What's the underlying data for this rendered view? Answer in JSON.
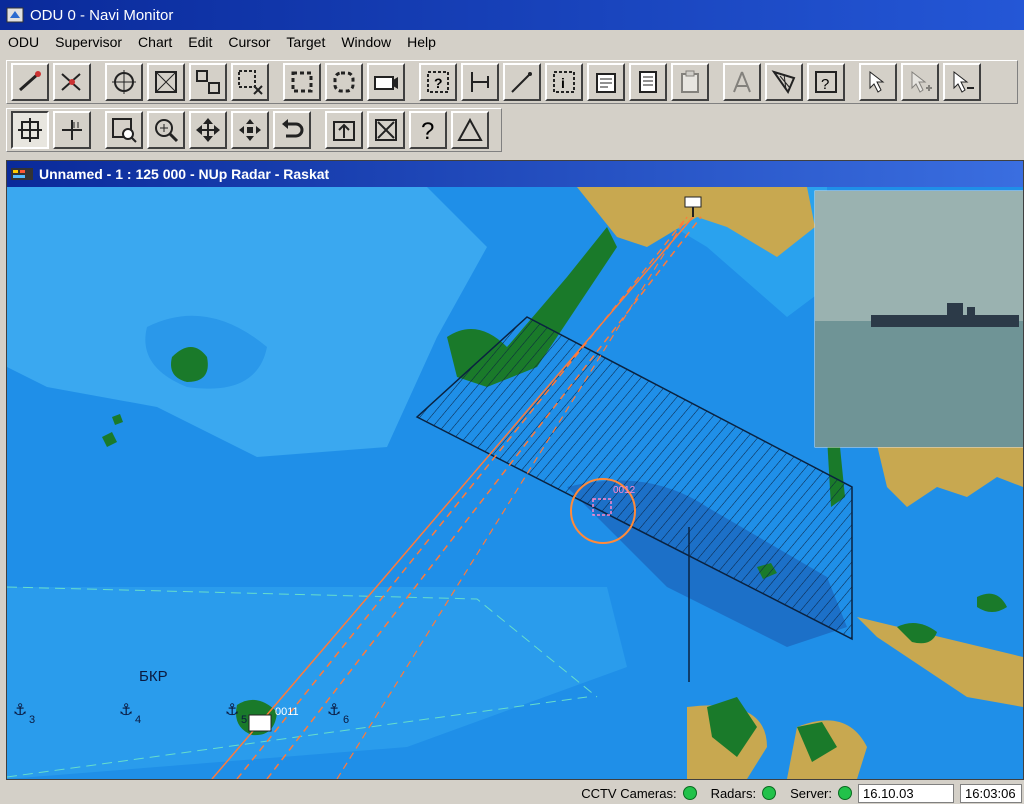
{
  "window": {
    "title": "ODU 0 - Navi Monitor"
  },
  "menu": [
    "ODU",
    "Supervisor",
    "Chart",
    "Edit",
    "Cursor",
    "Target",
    "Window",
    "Help"
  ],
  "toolbar1": [
    {
      "name": "telescope-icon",
      "group": 0
    },
    {
      "name": "target-telescope-icon",
      "group": 0
    },
    {
      "name": "crosshair-icon",
      "group": 1
    },
    {
      "name": "select-cross-icon",
      "group": 1
    },
    {
      "name": "expand-frame-icon",
      "group": 1
    },
    {
      "name": "close-frame-icon",
      "group": 1
    },
    {
      "name": "rect-select-icon",
      "group": 2
    },
    {
      "name": "round-select-icon",
      "group": 2
    },
    {
      "name": "camera-icon",
      "group": 2
    },
    {
      "name": "query-icon",
      "group": 3
    },
    {
      "name": "measure-icon",
      "group": 3
    },
    {
      "name": "pen-icon",
      "group": 3
    },
    {
      "name": "info-icon",
      "group": 3
    },
    {
      "name": "notes-icon",
      "group": 3
    },
    {
      "name": "list-icon",
      "group": 3
    },
    {
      "name": "clipboard-icon",
      "group": 3,
      "disabled": true
    },
    {
      "name": "compass-icon",
      "group": 4,
      "disabled": true
    },
    {
      "name": "net-select-icon",
      "group": 4
    },
    {
      "name": "help-cursor-icon",
      "group": 4
    },
    {
      "name": "edit-cursor-icon",
      "group": 5
    },
    {
      "name": "add-cursor-icon",
      "group": 5,
      "disabled": true
    },
    {
      "name": "remove-cursor-icon",
      "group": 5
    }
  ],
  "toolbar2": [
    {
      "name": "center-icon",
      "selected": true
    },
    {
      "name": "measure-cross-icon"
    },
    {
      "name": "zoom-rect-icon"
    },
    {
      "name": "zoom-icon"
    },
    {
      "name": "pan-icon"
    },
    {
      "name": "move-icon"
    },
    {
      "name": "undo-icon"
    },
    {
      "name": "upload-icon"
    },
    {
      "name": "delete-icon"
    },
    {
      "name": "help-icon"
    },
    {
      "name": "triangle-icon"
    }
  ],
  "map": {
    "title": "Unnamed - 1 : 125 000 - NUp  Radar - Raskat",
    "label_bkp": "БКР",
    "track_id_1": "0011",
    "track_id_2": "0012",
    "anchor_labels": [
      "3",
      "4",
      "5",
      "6"
    ],
    "colors": {
      "sea": "#1f8fe8",
      "shallow": "#3ab0f0",
      "land": "#c8a850",
      "green": "#1a7a2a",
      "track": "#ff7a3a"
    }
  },
  "status": {
    "cctv_label": "CCTV Cameras:",
    "radars_label": "Radars:",
    "server_label": "Server:",
    "date": "16.10.03",
    "time": "16:03:06"
  }
}
